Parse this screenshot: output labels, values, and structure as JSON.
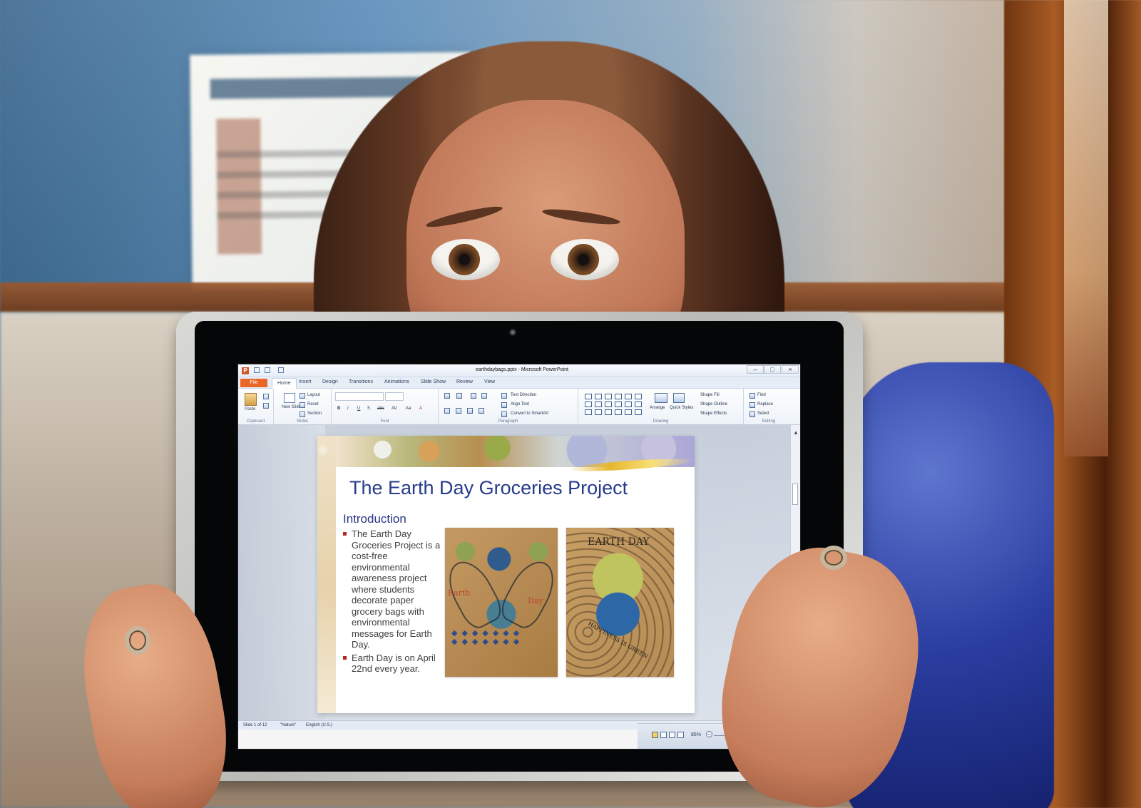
{
  "window": {
    "title": "earthdaybags.pptx - Microsoft PowerPoint",
    "app_icon": "P"
  },
  "tabs": [
    "File",
    "Home",
    "Insert",
    "Design",
    "Transitions",
    "Animations",
    "Slide Show",
    "Review",
    "View"
  ],
  "ribbon": {
    "clipboard": {
      "paste": "Paste",
      "group": "Clipboard"
    },
    "slides": {
      "new_slide": "New Slide",
      "layout": "Layout",
      "reset": "Reset",
      "section": "Section",
      "group": "Slides"
    },
    "font": {
      "buttons": [
        "B",
        "I",
        "U",
        "S",
        "abc",
        "AV",
        "Aa",
        "A"
      ],
      "group": "Font"
    },
    "paragraph": {
      "text_direction": "Text Direction",
      "align_text": "Align Text",
      "convert_smartart": "Convert to SmartArt",
      "group": "Paragraph"
    },
    "drawing": {
      "arrange": "Arrange",
      "quick_styles": "Quick Styles",
      "shape_fill": "Shape Fill",
      "shape_outline": "Shape Outline",
      "shape_effects": "Shape Effects",
      "group": "Drawing"
    },
    "editing": {
      "find": "Find",
      "replace": "Replace",
      "select": "Select",
      "group": "Editing"
    }
  },
  "slide": {
    "title": "The Earth Day Groceries Project",
    "section_title": "Introduction",
    "bullets": [
      "The Earth Day Groceries Project is a cost-free environmental awareness project where students decorate paper grocery bags with environmental messages for Earth Day.",
      "Earth Day is on April 22nd every year."
    ],
    "art_left": {
      "earth": "Earth",
      "day": "Day"
    },
    "art_right": {
      "top": "EARTH DAY",
      "bottom": "HAPPINESS IS GREEN"
    }
  },
  "status": {
    "slide": "Slide 1 of 12",
    "theme": "\"Nature\"",
    "language": "English (U.S.)",
    "zoom": "85%"
  }
}
